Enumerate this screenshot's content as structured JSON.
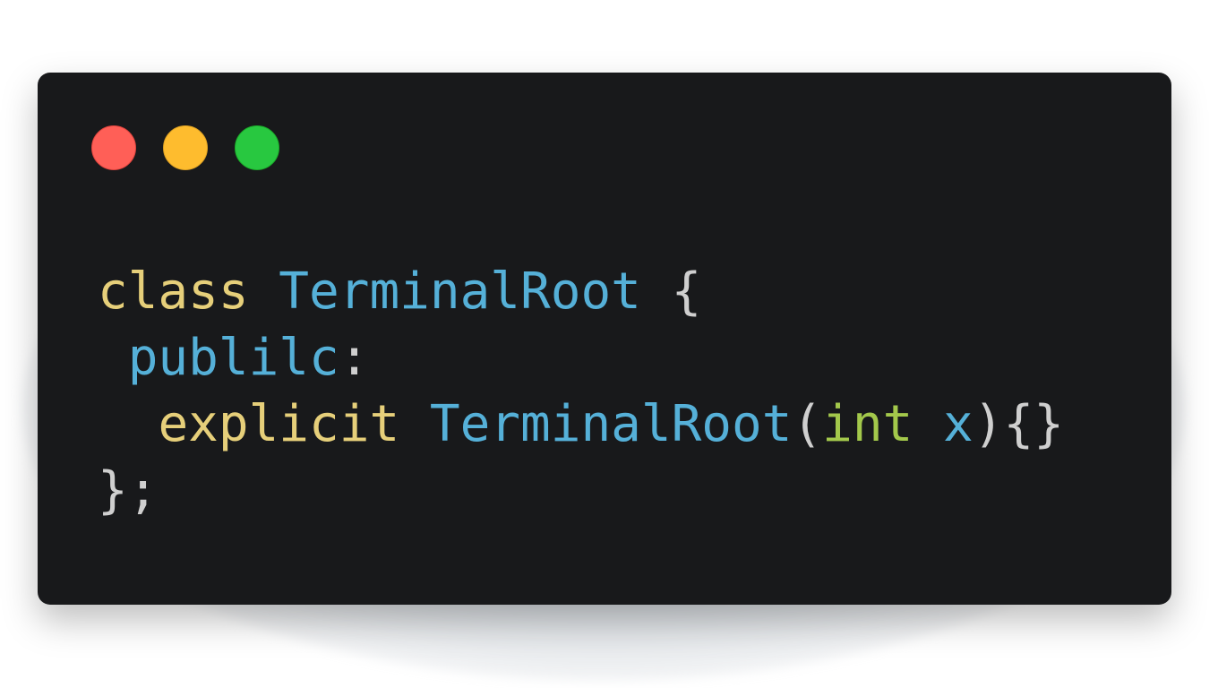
{
  "window": {
    "controls": [
      {
        "name": "close",
        "color": "#ff5f57",
        "border": "#e0443e"
      },
      {
        "name": "minimize",
        "color": "#febc2e",
        "border": "#dea123"
      },
      {
        "name": "maximize",
        "color": "#28c840",
        "border": "#1aab29"
      }
    ]
  },
  "colors": {
    "keyword": "#e6cf7a",
    "type_name": "#55b0d8",
    "punctuation": "#cfcfcf",
    "builtin_type": "#a3c84b"
  },
  "code": {
    "line1": {
      "keyword": "class",
      "name": "TerminalRoot",
      "brace": "{"
    },
    "line2": {
      "indent": " ",
      "access": "publilc",
      "colon": ":"
    },
    "line3": {
      "indent": "  ",
      "keyword": "explicit",
      "name": "TerminalRoot",
      "open_paren": "(",
      "param_type": "int",
      "param_name": "x",
      "close": "){}"
    },
    "line4": {
      "text": "};"
    }
  }
}
